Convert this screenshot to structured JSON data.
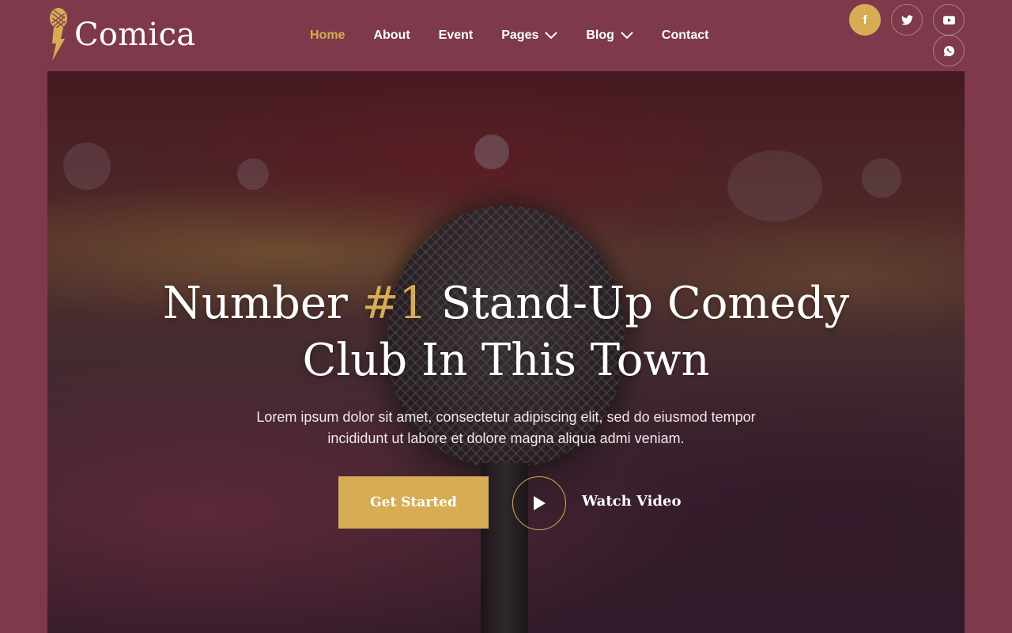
{
  "brand": {
    "name": "Comica",
    "logo_icon": "microphone-lightning-icon"
  },
  "nav": {
    "items": [
      {
        "label": "Home",
        "active": true
      },
      {
        "label": "About"
      },
      {
        "label": "Event"
      },
      {
        "label": "Pages",
        "dropdown": true
      },
      {
        "label": "Blog",
        "dropdown": true
      },
      {
        "label": "Contact"
      }
    ]
  },
  "social": [
    {
      "icon": "facebook-icon",
      "glyph": "f"
    },
    {
      "icon": "twitter-icon"
    },
    {
      "icon": "youtube-icon"
    },
    {
      "icon": "whatsapp-icon"
    }
  ],
  "hero": {
    "title_part1": "Number ",
    "title_accent": "#1",
    "title_part2": " Stand-Up Comedy",
    "title_line2": "Club In This Town",
    "description": "Lorem ipsum dolor sit amet, consectetur adipiscing elit, sed do eiusmod tempor incididunt ut labore et dolore magna aliqua admi veniam.",
    "cta_label": "Get Started",
    "video_label": "Watch Video"
  },
  "colors": {
    "background": "#7e3a4a",
    "accent": "#d6ad55",
    "text": "#ffffff"
  }
}
